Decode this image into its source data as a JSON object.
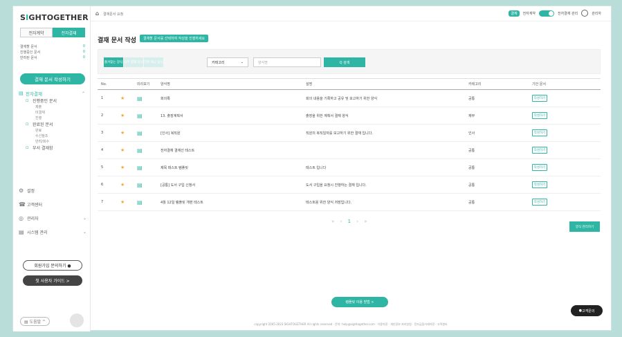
{
  "sidebar": {
    "logo_prefix": "S",
    "logo_accent": "I",
    "logo_rest": "GHTOGETHER",
    "tabs": [
      "전자계약",
      "전자결재"
    ],
    "links": [
      {
        "label": "결재할 문서",
        "count": "0"
      },
      {
        "label": "진행중인 문서",
        "count": "0"
      },
      {
        "label": "반려된 문서",
        "count": "0"
      }
    ],
    "new_doc_label": "결재 문서 작성하기",
    "menu_top": "전자결재",
    "menu_items": [
      {
        "label": "진행중인 문서",
        "subs": [
          "제출",
          "미결재",
          "진행"
        ]
      },
      {
        "label": "완료된 문서",
        "subs": [
          "완료",
          "수신참조",
          "반려/회수"
        ]
      },
      {
        "label": "부서 결재함",
        "subs": []
      }
    ],
    "menu2": [
      {
        "icon": "⚙",
        "label": "설정",
        "chev": ""
      },
      {
        "icon": "☎",
        "label": "고객센터",
        "chev": ""
      },
      {
        "icon": "◎",
        "label": "관리자",
        "chev": "⌄"
      },
      {
        "icon": "▤",
        "label": "시스템 관리",
        "chev": "⌄"
      }
    ],
    "pill1": "회원가입 문의하기 ●",
    "pill2": "첫 사용자 가이드 >",
    "footer_label": "도움말"
  },
  "topbar": {
    "home_label": "결재문서 요청",
    "badge": "결재",
    "toggle_label": "전자계약",
    "right_link": "전자결재 관리",
    "user": "관리자"
  },
  "page": {
    "title": "결재 문서 작성",
    "title_badge": "결재할 문서를 선택하여 작성을 진행하세요"
  },
  "filters": {
    "tabs": [
      "즐겨찾는 양식",
      "내부 결재 양식",
      "기본 제공 양식"
    ],
    "category_label": "카테고리",
    "search_placeholder": "양식명",
    "search_button": "Q 검색"
  },
  "table": {
    "headers": [
      "No.",
      "",
      "미리보기",
      "양식명",
      "설명",
      "카테고리",
      "기안 문서"
    ],
    "rows": [
      {
        "no": "1",
        "name": "회의록",
        "desc": "회의 내용을 기록하고 공유 및 보고하기 위한 양식",
        "cat": "공통",
        "btn": "작성하기"
      },
      {
        "no": "2",
        "name": "13. 출장계획서",
        "desc": "출장을 위한 계획서 결재 양식",
        "cat": "재무",
        "btn": "작성하기"
      },
      {
        "no": "3",
        "name": "[인사] 복직원",
        "desc": "직원의 복직일자를 보고하기 위한 결재 입니다.",
        "cat": "인사",
        "btn": "작성하기"
      },
      {
        "no": "4",
        "name": "전자결재 결재선 테스트",
        "desc": "",
        "cat": "공통",
        "btn": "작성하기"
      },
      {
        "no": "5",
        "name": "제목 테스트 템플릿",
        "desc": "테스트 입니다",
        "cat": "공통",
        "btn": "작성하기"
      },
      {
        "no": "6",
        "name": "[공통] 도서 구입 신청서",
        "desc": "도서 구입을 요청시 진행하는 결재 입니다.",
        "cat": "공통",
        "btn": "작성하기"
      },
      {
        "no": "7",
        "name": "4월 12일 템플릿 개편 테스트",
        "desc": "테스트용 위한 양식 저장입니다.",
        "cat": "공통",
        "btn": "작성하기"
      }
    ]
  },
  "pager": {
    "first": "«",
    "prev": "‹",
    "current": "1",
    "next": "›",
    "last": "»"
  },
  "add_button": "양식 관리하기",
  "how_button": "템플릿 이용 방법 >",
  "help_button": "고객문의",
  "footer": "copyright 2005-2023 SIGHTOGETHER All rights reserved · 문의: help@sightogether.com · 이용약관 · 개인정보 처리방침 · 전자금융거래약관 · 고객센터",
  "colors": {
    "accent": "#2eb5a3",
    "star": "#f0a83a"
  }
}
